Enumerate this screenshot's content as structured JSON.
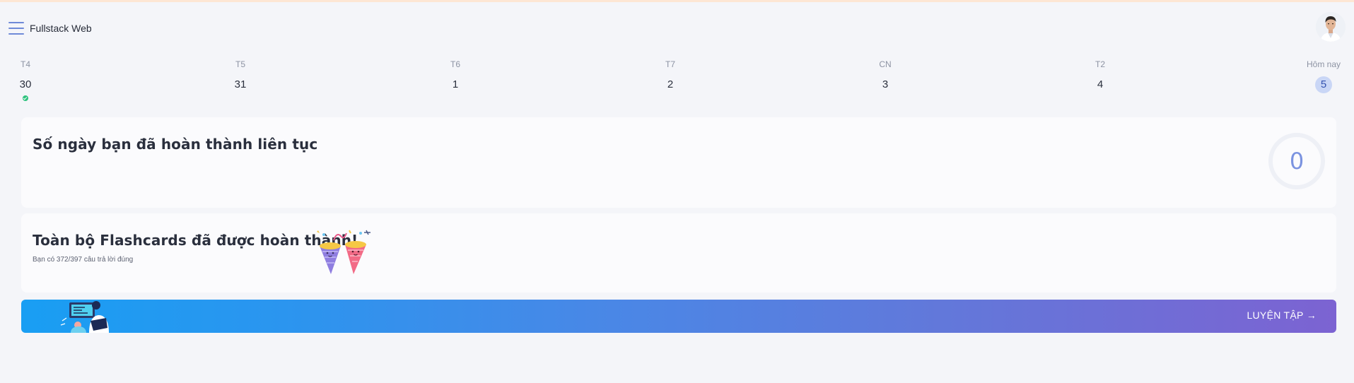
{
  "header": {
    "app_title": "Fullstack Web"
  },
  "week": [
    {
      "name": "T4",
      "num": "30",
      "done": true,
      "today": false
    },
    {
      "name": "T5",
      "num": "31",
      "done": false,
      "today": false
    },
    {
      "name": "T6",
      "num": "1",
      "done": false,
      "today": false
    },
    {
      "name": "T7",
      "num": "2",
      "done": false,
      "today": false
    },
    {
      "name": "CN",
      "num": "3",
      "done": false,
      "today": false
    },
    {
      "name": "T2",
      "num": "4",
      "done": false,
      "today": false
    },
    {
      "name": "Hôm nay",
      "num": "5",
      "done": false,
      "today": true
    }
  ],
  "streak": {
    "title": "Số ngày bạn đã hoàn thành liên tục",
    "value": "0"
  },
  "flashcards": {
    "title": "Toàn bộ Flashcards đã được hoàn thành!",
    "subtext": "Bạn có 372/397 câu trả lời đúng"
  },
  "banner": {
    "practice_label": "LUYỆN TẬP",
    "arrow": "→"
  },
  "colors": {
    "accent": "#7b93e0",
    "done": "#2ec27e",
    "banner_start": "#199ef3",
    "banner_end": "#7c63d2"
  }
}
